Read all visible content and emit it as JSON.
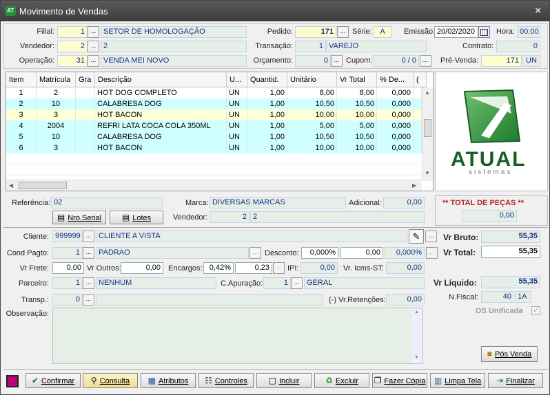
{
  "window": {
    "title": "Movimento de Vendas",
    "close": "×",
    "app_icon": "AT"
  },
  "header": {
    "filial_label": "Filial:",
    "filial_code": "1",
    "filial_name": "SETOR DE HOMOLOGAÇÃO",
    "vendedor_label": "Vendedor:",
    "vendedor_code": "2",
    "vendedor_name": "2",
    "operacao_label": "Operação:",
    "operacao_code": "31",
    "operacao_name": "VENDA MEI NOVO",
    "pedido_label": "Pedido:",
    "pedido": "171",
    "serie_label": "Série:",
    "serie": "A",
    "emissao_label": "Emissão:",
    "emissao": "20/02/2020",
    "hora_label": "Hora:",
    "hora": "00:00",
    "transacao_label": "Transação:",
    "transacao_code": "1",
    "transacao_name": "VAREJO",
    "contrato_label": "Contrato:",
    "contrato": "0",
    "orcamento_label": "Orçamento:",
    "orcamento": "0",
    "cupom_label": "Cupom:",
    "cupom": "0 / 0",
    "prevenda_label": "Pré-Venda:",
    "prevenda": "171",
    "prevenda_un": "UN"
  },
  "grid": {
    "columns": [
      "Item",
      "Matrícula",
      "Gra",
      "Descrição",
      "U...",
      "Quantid.",
      "Unitário",
      "Vr Total",
      "% De...",
      "("
    ],
    "rows": [
      {
        "item": "1",
        "matricula": "2",
        "gra": "",
        "descricao": "HOT DOG COMPLETO",
        "un": "UN",
        "quant": "1,00",
        "unitario": "8,00",
        "total": "8,00",
        "desc": "0,000"
      },
      {
        "item": "2",
        "matricula": "10",
        "gra": "",
        "descricao": "CALABRESA DOG",
        "un": "UN",
        "quant": "1,00",
        "unitario": "10,50",
        "total": "10,50",
        "desc": "0,000"
      },
      {
        "item": "3",
        "matricula": "3",
        "gra": "",
        "descricao": "HOT BACON",
        "un": "UN",
        "quant": "1,00",
        "unitario": "10,00",
        "total": "10,00",
        "desc": "0,000"
      },
      {
        "item": "4",
        "matricula": "2004",
        "gra": "",
        "descricao": "REFRI LATA COCA COLA 350ML",
        "un": "UN",
        "quant": "1,00",
        "unitario": "5,00",
        "total": "5,00",
        "desc": "0,000"
      },
      {
        "item": "5",
        "matricula": "10",
        "gra": "",
        "descricao": "CALABRESA DOG",
        "un": "UN",
        "quant": "1,00",
        "unitario": "10,50",
        "total": "10,50",
        "desc": "0,000"
      },
      {
        "item": "6",
        "matricula": "3",
        "gra": "",
        "descricao": "HOT BACON",
        "un": "UN",
        "quant": "1,00",
        "unitario": "10,00",
        "total": "10,00",
        "desc": "0,000"
      }
    ]
  },
  "logo": {
    "word": "ATUAL",
    "sub": "sistemas",
    "color": "#2e8b3d"
  },
  "itemdetail": {
    "referencia_label": "Referência:",
    "referencia": "02",
    "marca_label": "Marca:",
    "marca": "DIVERSAS MARCAS",
    "adicional_label": "Adicional:",
    "adicional": "0,00",
    "nro_serial": "Nro.Serial",
    "lotes": "Lotes",
    "vendedor_label": "Vendedor:",
    "vendedor_code": "2",
    "vendedor_name": "2",
    "total_pecas_label": "** TOTAL DE PEÇAS **",
    "total_pecas": "0,00"
  },
  "footer": {
    "cliente_label": "Cliente:",
    "cliente_code": "999999",
    "cliente_name": "CLIENTE A VISTA",
    "condpagto_label": "Cond Pagto:",
    "condpagto_code": "1",
    "condpagto_name": "PADRAO",
    "desconto_label": "Desconto:",
    "desconto_pct": "0,000%",
    "desconto_val": "0,00",
    "desconto_pct2": "0,000%",
    "vrfrete_label": "Vr Frete:",
    "vrfrete": "0,00",
    "vroutros_label": "Vr Outros:",
    "vroutros": "0,00",
    "encargos_label": "Encargos:",
    "encargos_pct": "0,42%",
    "encargos_val": "0,23",
    "ipi_label": "IPI:",
    "ipi": "0,00",
    "icmsst_label": "Vr. Icms-ST:",
    "icmsst": "0,00",
    "parceiro_label": "Parceiro:",
    "parceiro_code": "1",
    "parceiro_name": "NENHUM",
    "capuracao_label": "C.Apuração:",
    "capuracao_code": "1",
    "capuracao_name": "GERAL",
    "transp_label": "Transp.:",
    "transp_code": "0",
    "retencoes_label": "(-) Vr.Retenções:",
    "retencoes": "0,00",
    "observacao_label": "Observação:",
    "observacao": "",
    "vrbruto_label": "Vr Bruto:",
    "vrbruto": "55,35",
    "vrtotal_label": "Vr Total:",
    "vrtotal": "55,35",
    "vrliquido_label": "Vr Líquido:",
    "vrliquido": "55,35",
    "nfiscal_label": "N.Fiscal:",
    "nfiscal": "40",
    "nfiscal_serie": "1A",
    "os_unificada_label": "OS Unificada",
    "posvenda": "Pós Venda"
  },
  "toolbar": {
    "confirmar": "Confirmar",
    "consulta": "Consulta",
    "atributos": "Atributos",
    "controles": "Controles",
    "incluir": "Incluir",
    "excluir": "Excluir",
    "fazer_copia": "Fazer Cópia",
    "limpa_tela": "Limpa Tela",
    "finalizar": "Finalizar"
  }
}
